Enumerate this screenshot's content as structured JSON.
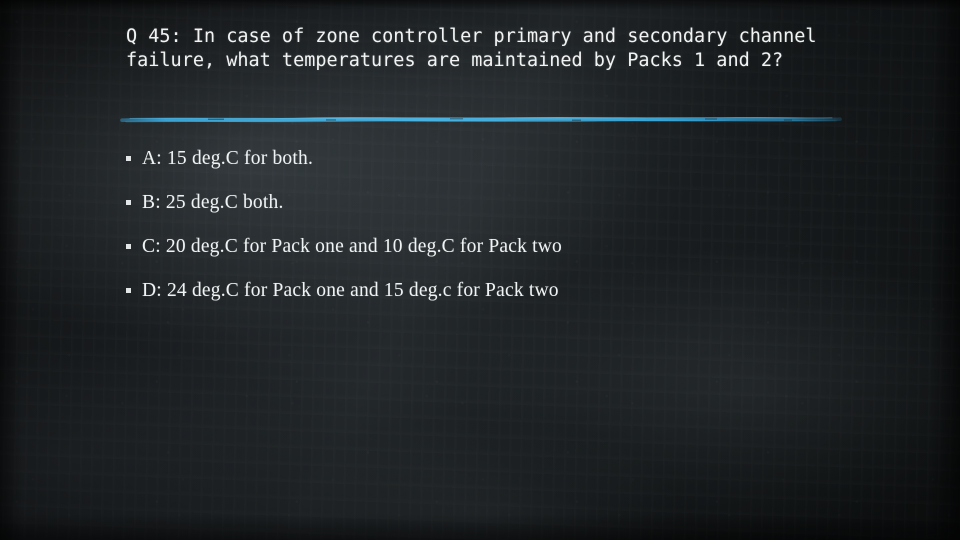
{
  "slide": {
    "background_color": "#15181a",
    "accent_color": "#3aa7d8",
    "text_color": "#f0f3f3",
    "question": "Q 45: In case of zone controller primary and secondary channel failure, what temperatures are maintained by Packs 1 and 2?",
    "divider_name": "chalk-underline",
    "answers": [
      {
        "bullet": "square-bullet",
        "text": "A: 15 deg.C for both."
      },
      {
        "bullet": "square-bullet",
        "text": "B: 25 deg.C both."
      },
      {
        "bullet": "square-bullet",
        "text": "C: 20 deg.C for Pack one and 10 deg.C for Pack two"
      },
      {
        "bullet": "square-bullet",
        "text": "D: 24 deg.C for Pack one and 15 deg.c for Pack two"
      }
    ]
  }
}
